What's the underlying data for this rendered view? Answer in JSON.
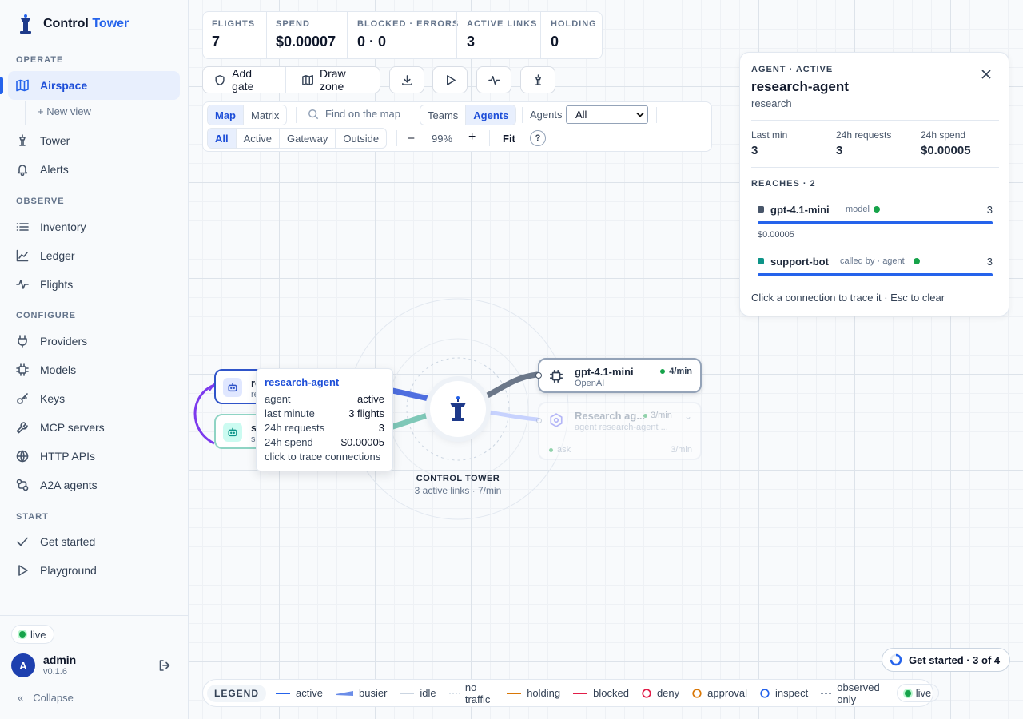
{
  "app": {
    "name": "Control",
    "name_accent": "Tower"
  },
  "sidebar": {
    "sections": {
      "operate": "OPERATE",
      "observe": "OBSERVE",
      "configure": "CONFIGURE",
      "start": "START"
    },
    "items": {
      "airspace": "Airspace",
      "new_view": "+ New view",
      "tower": "Tower",
      "alerts": "Alerts",
      "inventory": "Inventory",
      "ledger": "Ledger",
      "flights": "Flights",
      "providers": "Providers",
      "models": "Models",
      "keys": "Keys",
      "mcp": "MCP servers",
      "http": "HTTP APIs",
      "a2a": "A2A agents",
      "get_started": "Get started",
      "playground": "Playground"
    },
    "status": "live",
    "user": {
      "initial": "A",
      "name": "admin",
      "version": "v0.1.6"
    },
    "collapse": "Collapse"
  },
  "stats": [
    {
      "label": "FLIGHTS",
      "value": "7"
    },
    {
      "label": "SPEND",
      "value": "$0.00007"
    },
    {
      "label": "BLOCKED · ERRORS",
      "value": "0 · 0"
    },
    {
      "label": "ACTIVE LINKS",
      "value": "3"
    },
    {
      "label": "HOLDING",
      "value": "0"
    }
  ],
  "toolbar": {
    "add_gate": "Add gate",
    "draw_zone": "Draw zone"
  },
  "controls": {
    "view_map": "Map",
    "view_matrix": "Matrix",
    "search_placeholder": "Find on the map",
    "group_teams": "Teams",
    "group_agents": "Agents",
    "agents_label": "Agents",
    "agents_select": "All",
    "filters": [
      "All",
      "Active",
      "Gateway",
      "Outside"
    ],
    "zoom_out": "–",
    "zoom": "99%",
    "zoom_in": "+",
    "fit": "Fit",
    "help": "?"
  },
  "map": {
    "tower": {
      "title": "CONTROL TOWER",
      "subtitle": "3 active links · 7/min"
    },
    "agents": [
      {
        "name": "research-agent",
        "sub": "research"
      },
      {
        "name": "support-bot",
        "sub": "support"
      }
    ],
    "targets": [
      {
        "name": "gpt-4.1-mini",
        "sub": "OpenAI",
        "rate": "4/min"
      },
      {
        "name": "Research ag...",
        "sub": "agent research-agent ...",
        "rate": "3/min",
        "skill": "ask",
        "skill_rate": "3/min"
      }
    ],
    "tooltip": {
      "title": "research-agent",
      "rows": [
        {
          "k": "agent",
          "v": "active"
        },
        {
          "k": "last minute",
          "v": "3 flights"
        },
        {
          "k": "24h requests",
          "v": "3"
        },
        {
          "k": "24h spend",
          "v": "$0.00005"
        }
      ],
      "hint": "click to trace connections"
    }
  },
  "panel": {
    "kicker": "AGENT · ACTIVE",
    "title": "research-agent",
    "subtitle": "research",
    "metrics": [
      {
        "label": "Last min",
        "value": "3"
      },
      {
        "label": "24h requests",
        "value": "3"
      },
      {
        "label": "24h spend",
        "value": "$0.00005"
      }
    ],
    "reaches_label": "REACHES · 2",
    "reaches": [
      {
        "name": "gpt-4.1-mini",
        "kind": "model",
        "count": "3",
        "cost": "$0.00005",
        "fill": 1.0,
        "color": "#475569"
      },
      {
        "name": "support-bot",
        "kind": "called by · agent",
        "count": "3",
        "fill": 1.0,
        "color": "#0d9488"
      }
    ],
    "footer": "Click a connection to trace it · Esc to clear"
  },
  "get_started": "Get started · 3 of 4",
  "legend": {
    "title": "LEGEND",
    "items": [
      "active",
      "busier",
      "idle",
      "no traffic",
      "holding",
      "blocked",
      "deny",
      "approval",
      "inspect",
      "observed only"
    ],
    "live": "live"
  }
}
